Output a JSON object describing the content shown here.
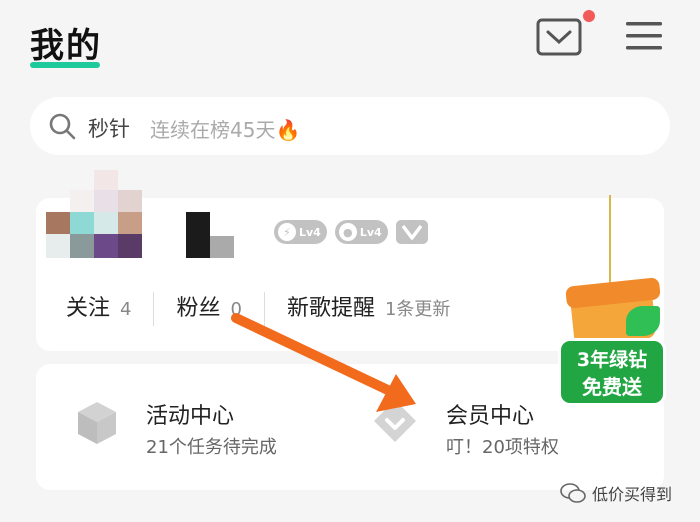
{
  "header": {
    "title": "我的",
    "accent": "#1ec99b"
  },
  "search": {
    "keyword": "秒针",
    "tip": "连续在榜45天🔥"
  },
  "profile": {
    "badges": [
      {
        "icon": "lightning-icon",
        "level": "Lv4"
      },
      {
        "icon": "disc-icon",
        "level": "Lv4"
      }
    ],
    "stats": [
      {
        "label": "关注",
        "value": "4"
      },
      {
        "label": "粉丝",
        "value": "0"
      },
      {
        "label": "新歌提醒",
        "value": "1条更新"
      }
    ]
  },
  "cards": {
    "activity": {
      "title": "活动中心",
      "subtitle": "21个任务待完成"
    },
    "vip": {
      "title": "会员中心",
      "subtitle": "叮！20项特权"
    }
  },
  "promo": {
    "line1": "3年绿钻",
    "line2": "免费送"
  },
  "watermark": {
    "text": "低价买得到"
  }
}
